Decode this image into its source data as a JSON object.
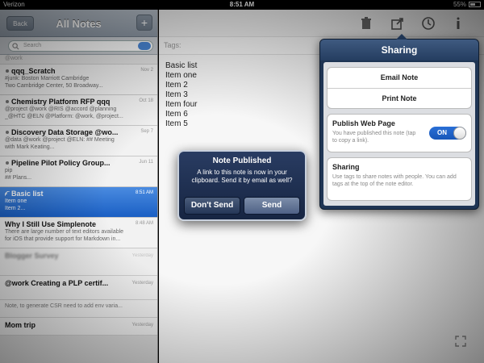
{
  "status_bar": {
    "carrier": "Verizon",
    "time": "8:51 AM",
    "battery": "55%"
  },
  "left_panel": {
    "back_label": "Back",
    "title": "All Notes",
    "add_label": "+",
    "search_placeholder": "Search",
    "top_strip": "@work",
    "notes": [
      {
        "title": "qqq_Scratch",
        "date": "Nov 2",
        "preview1": "#junk: Boston Marriott Cambridge",
        "preview2": "Two Cambridge Center, 50 Broadway..."
      },
      {
        "title": "Chemistry Platform RFP qqq",
        "date": "Oct 18",
        "preview1": "@project @work @RIS @accord @planning",
        "preview2": "_@HTC @ELN @Platform: @work, @project..."
      },
      {
        "title": "Discovery Data Storage @wo...",
        "date": "Sep 7",
        "preview1": "@data @work @project @ELN: ## Meeting",
        "preview2": "with Mark Keating..."
      },
      {
        "title": "Pipeline Pilot Policy Group...",
        "date": "Jun 11",
        "preview1": "pip",
        "preview2": "## Plans..."
      },
      {
        "title": "Basic list",
        "date": "8:51 AM",
        "preview1": "Item one",
        "preview2": "Item 2..."
      },
      {
        "title": "Why I Still Use Simplenote",
        "date": "8:48 AM",
        "preview1": "There are large number of text editors available",
        "preview2": "for iOS that provide support for Markdown in..."
      }
    ],
    "blurred_rows": [
      {
        "title": "Blogger Survey",
        "date": "Yesterday"
      },
      {
        "title": "@work Creating a PLP certif...",
        "date": "Yesterday"
      },
      {
        "title": "Note, to generate CSR need to add env varia...",
        "date": ""
      },
      {
        "title": "Mom trip",
        "date": "Yesterday"
      }
    ]
  },
  "editor": {
    "tags_label": "Tags:",
    "lines": [
      "Basic list",
      "",
      "Item one",
      "Item 2",
      "Item 3",
      "Item four",
      "Item 6",
      "Item 5"
    ]
  },
  "sharing": {
    "title": "Sharing",
    "email_label": "Email Note",
    "print_label": "Print Note",
    "publish_label": "Publish Web Page",
    "publish_desc": "You have published this note (tap to copy a link).",
    "toggle_label": "ON",
    "share_label": "Sharing",
    "share_desc": "Use tags to share notes with people. You can add tags at the top of the note editor."
  },
  "alert": {
    "title": "Note Published",
    "message": "A link to this note is now in your clipboard. Send it by email as well?",
    "dont_send": "Don't Send",
    "send": "Send"
  }
}
